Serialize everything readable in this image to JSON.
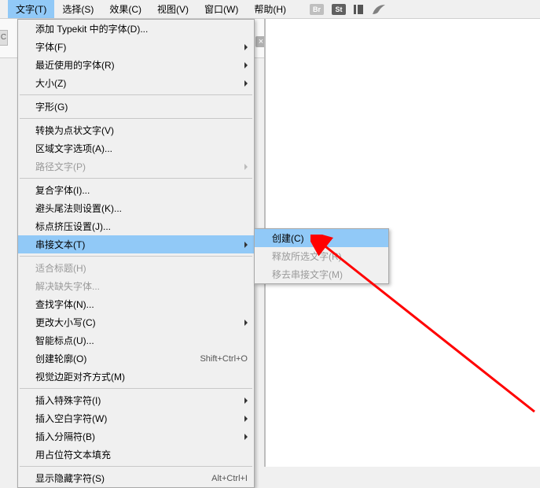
{
  "menubar": {
    "items": [
      {
        "label": "文字(T)"
      },
      {
        "label": "选择(S)"
      },
      {
        "label": "效果(C)"
      },
      {
        "label": "视图(V)"
      },
      {
        "label": "窗口(W)"
      },
      {
        "label": "帮助(H)"
      }
    ],
    "br": "Br",
    "st": "St"
  },
  "tabclose": "×",
  "lefttab": "C",
  "dropdown": {
    "items": [
      {
        "label": "添加 Typekit 中的字体(D)...",
        "type": "item"
      },
      {
        "label": "字体(F)",
        "type": "submenu"
      },
      {
        "label": "最近使用的字体(R)",
        "type": "submenu"
      },
      {
        "label": "大小(Z)",
        "type": "submenu"
      },
      {
        "type": "sep"
      },
      {
        "label": "字形(G)",
        "type": "item"
      },
      {
        "type": "sep"
      },
      {
        "label": "转换为点状文字(V)",
        "type": "item"
      },
      {
        "label": "区域文字选项(A)...",
        "type": "item"
      },
      {
        "label": "路径文字(P)",
        "type": "submenu",
        "disabled": true
      },
      {
        "type": "sep"
      },
      {
        "label": "复合字体(I)...",
        "type": "item"
      },
      {
        "label": "避头尾法则设置(K)...",
        "type": "item"
      },
      {
        "label": "标点挤压设置(J)...",
        "type": "item"
      },
      {
        "label": "串接文本(T)",
        "type": "submenu",
        "highlight": true
      },
      {
        "type": "sep"
      },
      {
        "label": "适合标题(H)",
        "type": "item",
        "disabled": true
      },
      {
        "label": "解决缺失字体...",
        "type": "item",
        "disabled": true
      },
      {
        "label": "查找字体(N)...",
        "type": "item"
      },
      {
        "label": "更改大小写(C)",
        "type": "submenu"
      },
      {
        "label": "智能标点(U)...",
        "type": "item"
      },
      {
        "label": "创建轮廓(O)",
        "type": "item",
        "shortcut": "Shift+Ctrl+O"
      },
      {
        "label": "视觉边距对齐方式(M)",
        "type": "item"
      },
      {
        "type": "sep"
      },
      {
        "label": "插入特殊字符(I)",
        "type": "submenu"
      },
      {
        "label": "插入空白字符(W)",
        "type": "submenu"
      },
      {
        "label": "插入分隔符(B)",
        "type": "submenu"
      },
      {
        "label": "用占位符文本填充",
        "type": "item"
      },
      {
        "type": "sep"
      },
      {
        "label": "显示隐藏字符(S)",
        "type": "item",
        "shortcut": "Alt+Ctrl+I"
      }
    ]
  },
  "submenu": {
    "items": [
      {
        "label": "创建(C)",
        "highlight": true
      },
      {
        "label": "释放所选文字(R)",
        "disabled": true
      },
      {
        "label": "移去串接文字(M)",
        "disabled": true
      }
    ]
  }
}
